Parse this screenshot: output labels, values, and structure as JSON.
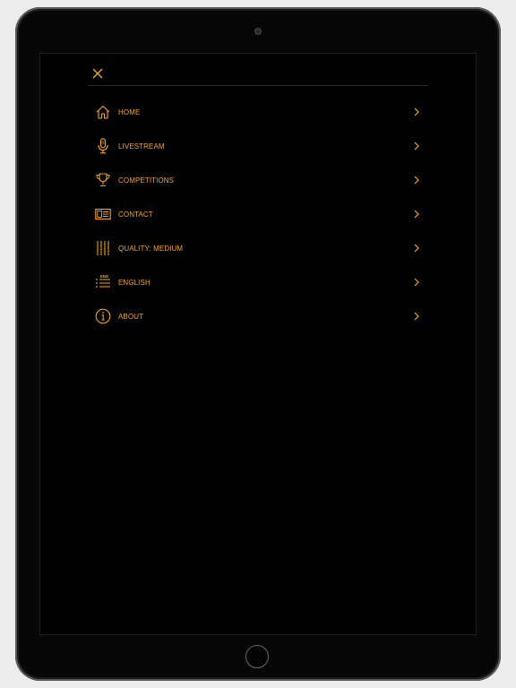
{
  "accent_color": "#f2a51e",
  "menu": {
    "close_icon": "close-icon",
    "items": [
      {
        "label": "HOME",
        "icon": "home-icon"
      },
      {
        "label": "LIVESTREAM",
        "icon": "microphone-icon"
      },
      {
        "label": "COMPETITIONS",
        "icon": "trophy-icon"
      },
      {
        "label": "CONTACT",
        "icon": "contact-card-icon"
      },
      {
        "label": "QUALITY: MEDIUM",
        "icon": "equalizer-icon"
      },
      {
        "label": "ENGLISH",
        "icon": "language-list-icon",
        "icon_text": "ENG"
      },
      {
        "label": "ABOUT",
        "icon": "info-icon"
      }
    ]
  }
}
